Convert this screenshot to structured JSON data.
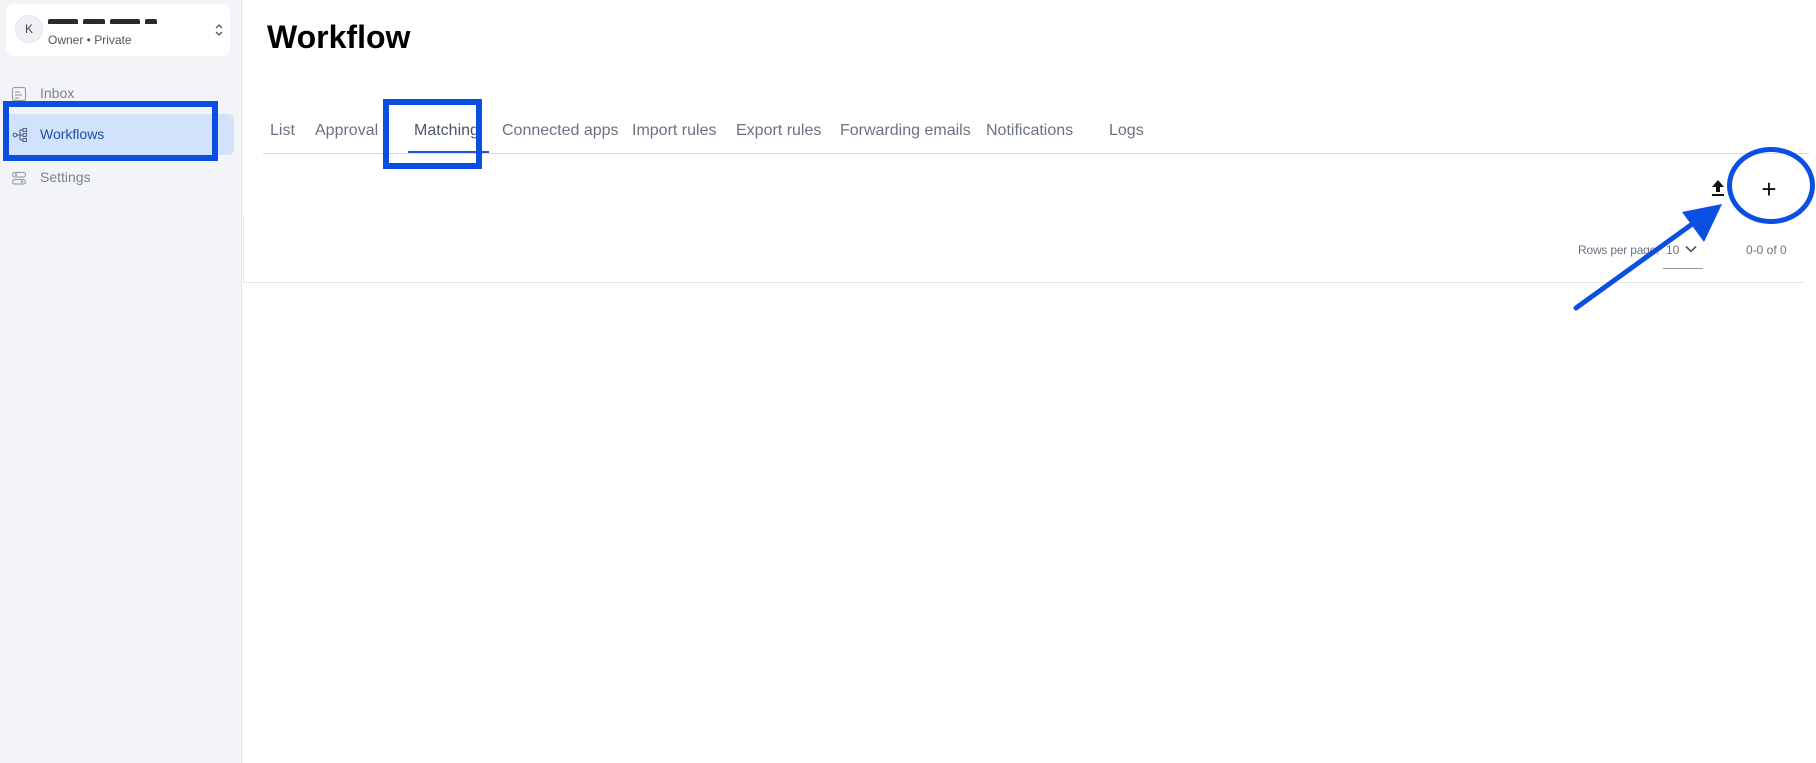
{
  "account": {
    "avatar_initial": "K",
    "subtitle": "Owner • Private"
  },
  "sidebar": {
    "items": [
      {
        "label": "Inbox",
        "icon": "inbox-icon"
      },
      {
        "label": "Workflows",
        "icon": "workflow-icon",
        "active": true
      },
      {
        "label": "Settings",
        "icon": "settings-icon"
      }
    ]
  },
  "page": {
    "title": "Workflow"
  },
  "tabs": [
    {
      "label": "List"
    },
    {
      "label": "Approval"
    },
    {
      "label": "Matching",
      "active": true
    },
    {
      "label": "Connected apps"
    },
    {
      "label": "Import rules"
    },
    {
      "label": "Export rules"
    },
    {
      "label": "Forwarding emails"
    },
    {
      "label": "Notifications"
    },
    {
      "label": "Logs"
    }
  ],
  "toolbar": {
    "upload_icon": "upload-icon",
    "add_label": "+"
  },
  "pagination": {
    "rows_per_page_label": "Rows per page:",
    "rows_per_page_value": "10",
    "range_text": "0-0 of  0"
  },
  "colors": {
    "accent": "#1a57d9",
    "annotation": "#0b4fe0",
    "active_nav_bg": "#d3e2fb",
    "sidebar_bg": "#f3f4f8"
  }
}
